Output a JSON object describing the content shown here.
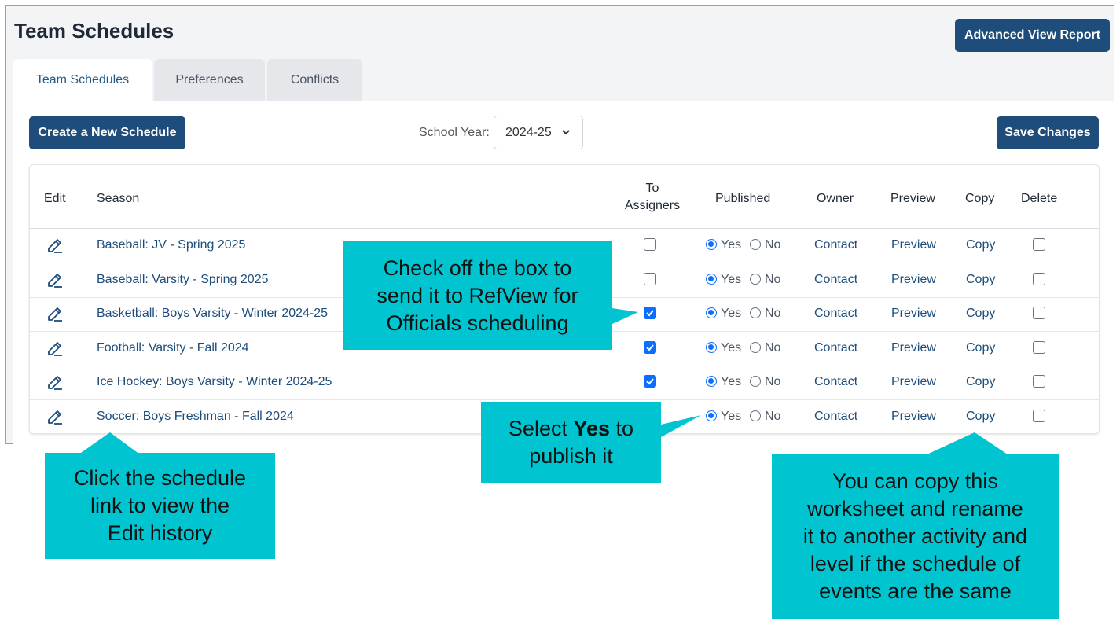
{
  "header": {
    "title": "Team Schedules",
    "advanced_button": "Advanced View Report"
  },
  "tabs": [
    {
      "label": "Team Schedules",
      "active": true
    },
    {
      "label": "Preferences",
      "active": false
    },
    {
      "label": "Conflicts",
      "active": false
    }
  ],
  "toolbar": {
    "create_label": "Create a New Schedule",
    "school_year_label": "School Year:",
    "school_year_value": "2024-25",
    "save_label": "Save Changes"
  },
  "table": {
    "headers": {
      "edit": "Edit",
      "season": "Season",
      "to_assigners_1": "To",
      "to_assigners_2": "Assigners",
      "published": "Published",
      "owner": "Owner",
      "preview": "Preview",
      "copy": "Copy",
      "delete": "Delete"
    },
    "rows": [
      {
        "season": "Baseball: JV - Spring 2025",
        "to_assigners": false,
        "published": "Yes",
        "yes": "Yes",
        "no": "No",
        "owner": "Contact",
        "preview": "Preview",
        "copy": "Copy",
        "delete": false
      },
      {
        "season": "Baseball: Varsity - Spring 2025",
        "to_assigners": false,
        "published": "Yes",
        "yes": "Yes",
        "no": "No",
        "owner": "Contact",
        "preview": "Preview",
        "copy": "Copy",
        "delete": false
      },
      {
        "season": "Basketball: Boys Varsity - Winter 2024-25",
        "to_assigners": true,
        "published": "Yes",
        "yes": "Yes",
        "no": "No",
        "owner": "Contact",
        "preview": "Preview",
        "copy": "Copy",
        "delete": false
      },
      {
        "season": "Football: Varsity - Fall 2024",
        "to_assigners": true,
        "published": "Yes",
        "yes": "Yes",
        "no": "No",
        "owner": "Contact",
        "preview": "Preview",
        "copy": "Copy",
        "delete": false
      },
      {
        "season": "Ice Hockey: Boys Varsity - Winter 2024-25",
        "to_assigners": true,
        "published": "Yes",
        "yes": "Yes",
        "no": "No",
        "owner": "Contact",
        "preview": "Preview",
        "copy": "Copy",
        "delete": false
      },
      {
        "season": "Soccer: Boys Freshman - Fall 2024",
        "to_assigners": false,
        "published": "Yes",
        "yes": "Yes",
        "no": "No",
        "owner": "Contact",
        "preview": "Preview",
        "copy": "Copy",
        "delete": false
      }
    ]
  },
  "callouts": {
    "check_box": [
      "Check off the box to",
      "send it to RefView for",
      "Officials scheduling"
    ],
    "select_yes": {
      "pre": "Select ",
      "bold": "Yes",
      "post": " to",
      "line2": "publish it"
    },
    "edit_history": [
      "Click the schedule",
      "link to view the",
      "Edit history"
    ],
    "copy": [
      "You can copy this",
      "worksheet and rename",
      "it to another activity and",
      "level if the schedule of",
      "events are the same"
    ]
  },
  "colors": {
    "primary": "#1e4d7b",
    "callout": "#00c5d0",
    "checkbox_blue": "#0d6efd"
  }
}
